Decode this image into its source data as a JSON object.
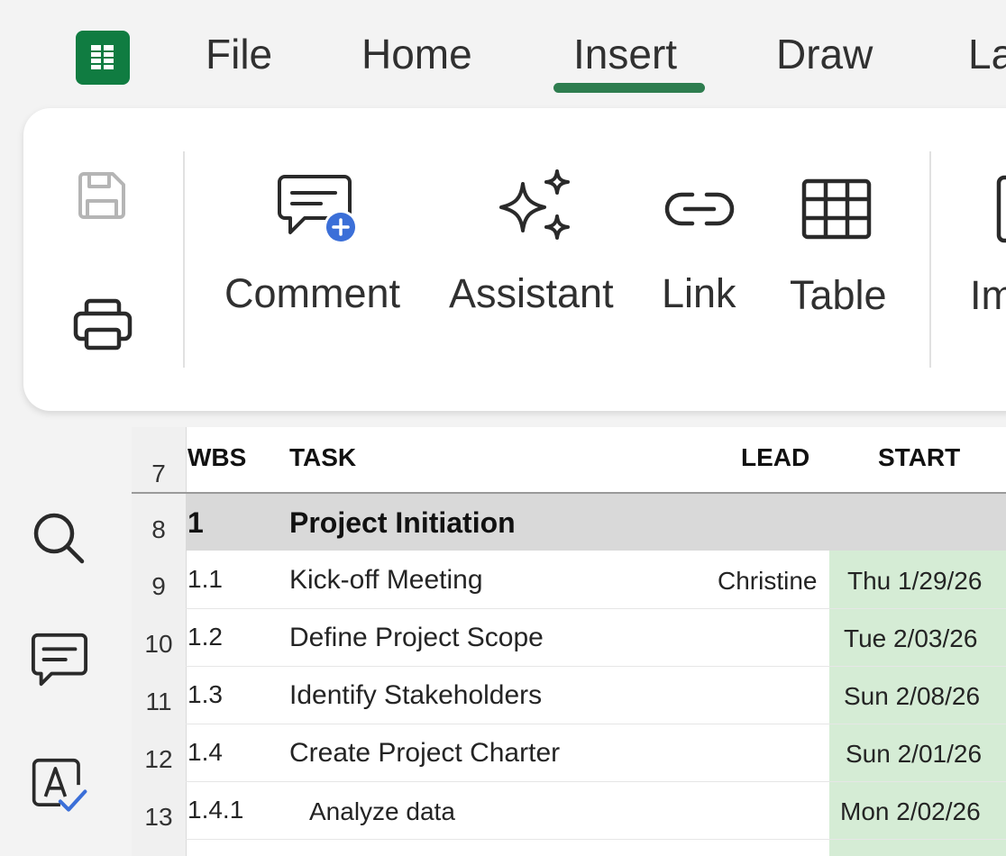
{
  "app": {
    "icon": "sheets-grid-icon",
    "brand_color": "#107c41"
  },
  "menu": {
    "items": [
      "File",
      "Home",
      "Insert",
      "Draw",
      "La"
    ],
    "active": "Insert",
    "active_color": "#2e7d4f"
  },
  "ribbon": {
    "quick": [
      {
        "name": "save",
        "icon": "save-icon"
      },
      {
        "name": "print",
        "icon": "printer-icon"
      }
    ],
    "buttons": [
      {
        "label": "Comment",
        "icon": "comment-add-icon"
      },
      {
        "label": "Assistant",
        "icon": "sparkle-icon"
      },
      {
        "label": "Link",
        "icon": "link-icon"
      },
      {
        "label": "Table",
        "icon": "table-icon"
      },
      {
        "label": "Im",
        "icon": "image-icon"
      }
    ]
  },
  "rail": [
    {
      "name": "search",
      "icon": "search-icon"
    },
    {
      "name": "comments",
      "icon": "comment-icon"
    },
    {
      "name": "proofing",
      "icon": "spellcheck-icon"
    }
  ],
  "sheet": {
    "header_row": {
      "row_number": "7",
      "wbs": "WBS",
      "task": "TASK",
      "lead": "LEAD",
      "start": "START"
    },
    "section_row": {
      "row_number": "8",
      "wbs": "1",
      "task": "Project Initiation"
    },
    "rows": [
      {
        "row_number": "9",
        "wbs": "1.1",
        "task": "Kick-off Meeting",
        "lead": "Christine",
        "start": "Thu 1/29/26"
      },
      {
        "row_number": "10",
        "wbs": "1.2",
        "task": "Define Project Scope",
        "lead": "",
        "start": "Tue 2/03/26"
      },
      {
        "row_number": "11",
        "wbs": "1.3",
        "task": "Identify Stakeholders",
        "lead": "",
        "start": "Sun 2/08/26"
      },
      {
        "row_number": "12",
        "wbs": "1.4",
        "task": "Create Project Charter",
        "lead": "",
        "start": "Sun 2/01/26"
      },
      {
        "row_number": "13",
        "wbs": "1.4.1",
        "task": "Analyze data",
        "lead": "",
        "start": "Mon 2/02/26"
      }
    ],
    "start_fill_color": "#d5ecd5",
    "section_fill_color": "#d9d9d9"
  }
}
